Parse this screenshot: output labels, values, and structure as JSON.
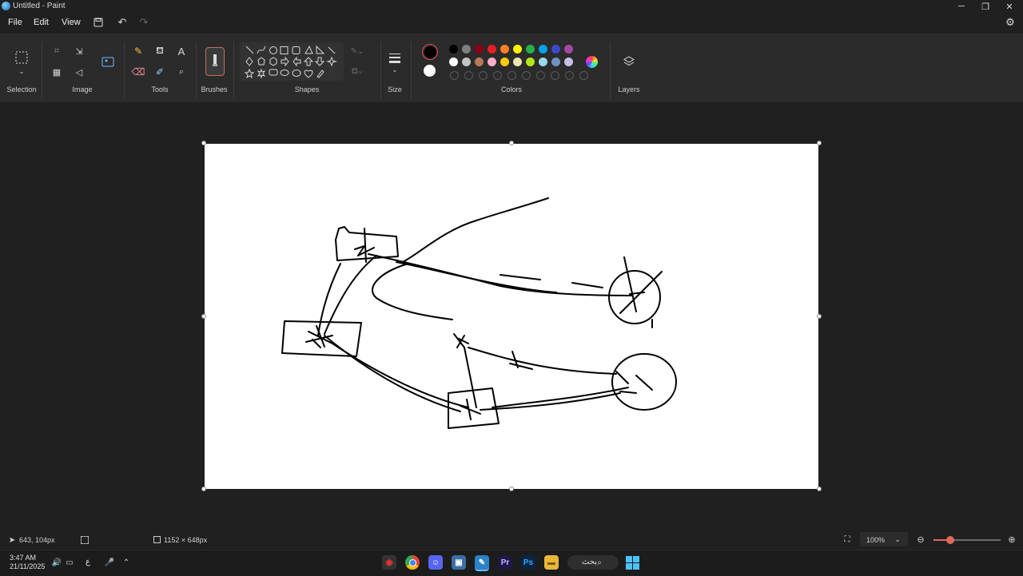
{
  "window": {
    "title": "Untitled - Paint"
  },
  "menu": {
    "file": "File",
    "edit": "Edit",
    "view": "View"
  },
  "ribbon": {
    "selection": "Selection",
    "image": "Image",
    "tools": "Tools",
    "brushes": "Brushes",
    "shapes": "Shapes",
    "size": "Size",
    "colors": "Colors",
    "layers": "Layers"
  },
  "palette": {
    "row1": [
      "#000000",
      "#7f7f7f",
      "#880015",
      "#ed1c24",
      "#ff7f27",
      "#fff200",
      "#22b14c",
      "#00a2e8",
      "#3f48cc",
      "#a349a4"
    ],
    "row2": [
      "#ffffff",
      "#c3c3c3",
      "#b97a57",
      "#ffaec9",
      "#ffc90e",
      "#efe4b0",
      "#b5e61d",
      "#99d9ea",
      "#7092be",
      "#c8bfe7"
    ],
    "primary": "#000000",
    "secondary": "#ffffff"
  },
  "status": {
    "cursor_pos": "643, 104px",
    "canvas_size": "1152 × 648px",
    "zoom": "100%",
    "zoom_level": 0.25
  },
  "taskbar": {
    "time": "3:47 AM",
    "date": "21/11/2025",
    "search": "بحث",
    "lang": "ع"
  }
}
